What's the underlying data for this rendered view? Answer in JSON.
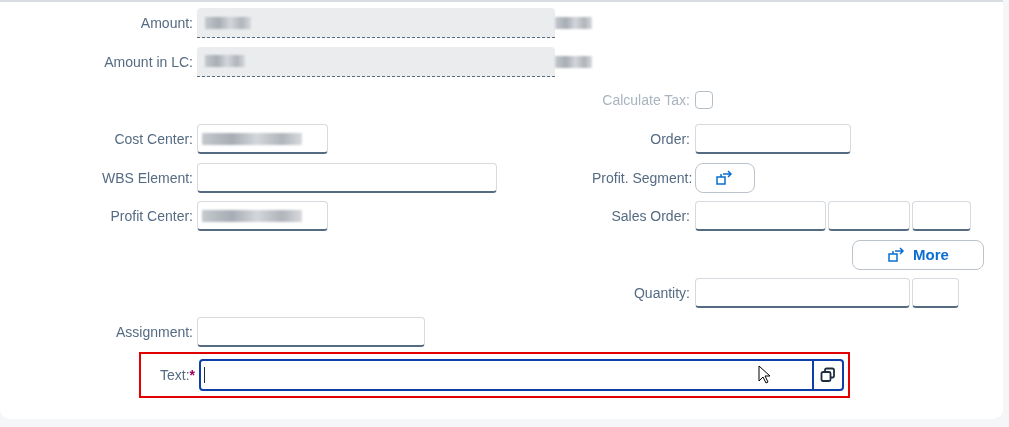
{
  "rows": [
    {
      "left": {
        "label": "Amount:",
        "kind": "readonly",
        "masked": true,
        "unit_masked": true
      }
    },
    {
      "left": {
        "label": "Amount in LC:",
        "kind": "readonly",
        "masked": true,
        "unit_masked": true
      }
    },
    {
      "right": {
        "label": "Calculate Tax:",
        "kind": "checkbox",
        "checked": false,
        "disabled": true
      }
    },
    {
      "left": {
        "label": "Cost Center:",
        "kind": "input",
        "masked": true
      },
      "right": {
        "label": "Order:",
        "kind": "input"
      }
    },
    {
      "left": {
        "label": "WBS Element:",
        "kind": "input"
      },
      "right": {
        "label": "Profit. Segment:",
        "kind": "icon_button"
      }
    },
    {
      "left": {
        "label": "Profit Center:",
        "kind": "input",
        "masked": true
      },
      "right": {
        "label": "Sales Order:",
        "kind": "input"
      }
    },
    {
      "right": {
        "kind": "button",
        "text": "More"
      }
    },
    {
      "right": {
        "label": "Quantity:",
        "kind": "input"
      }
    },
    {
      "left": {
        "label": "Assignment:",
        "kind": "input"
      }
    },
    {
      "left": {
        "label": "Text:",
        "kind": "input",
        "required_mark": "*",
        "focused": true,
        "value_help": true,
        "highlighted": true
      }
    }
  ]
}
